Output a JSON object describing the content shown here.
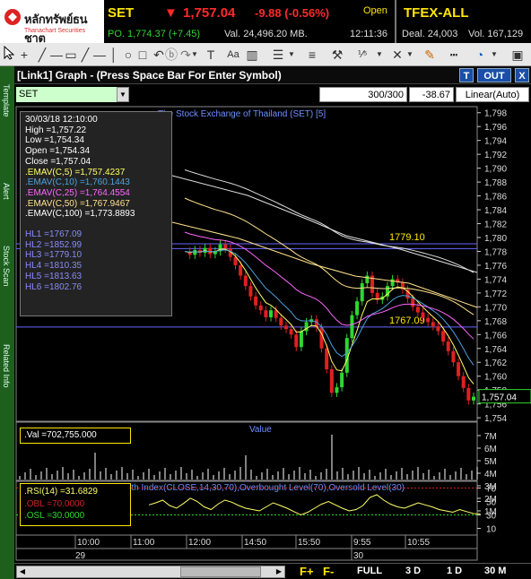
{
  "header": {
    "logo_th": "หลักทรัพย์ธนชาต",
    "logo_en": "Thanachart Securities",
    "index_name": "SET",
    "index_value": "1,757.04",
    "index_change": "-9.88 (-0.56%)",
    "market_status": "Open",
    "po": "PO. 1,774.37 (+7.45)",
    "value_mb": "Val. 24,496.20 MB.",
    "clock": "12:11:36",
    "tfex_name": "TFEX-ALL",
    "tfex_deal": "Deal. 24,003",
    "tfex_vol": "Vol. 167,129",
    "down_color": "#ff2a2a",
    "up_color": "#2fd62f",
    "accent": "#ffe600"
  },
  "toolbar": {
    "icons": [
      "cursor-icon",
      "crosshair-icon",
      "line-icon",
      "hline-icon",
      "rect-icon",
      "circle-icon",
      "square-icon",
      "undo-icon",
      "redo-icon",
      "text-icon",
      "text-tool-label",
      "candle-type-icon",
      "pen-icon",
      "line-width-icon",
      "line-style-icon",
      "tools-icon",
      "wave-icon",
      "delete-icon",
      "pencil-icon",
      "dashed-line-icon",
      "clock-icon",
      "dropdown-icon"
    ],
    "text_tool_label": "Aa"
  },
  "sidebar": {
    "labels": [
      "Template",
      "Alert",
      "Stock Scan",
      "Related Info"
    ]
  },
  "panel": {
    "title": "[Link1] Graph - (Press Space Bar For Enter Symbol)",
    "btn_t": "T",
    "btn_out": "OUT",
    "btn_x": "X",
    "btn_t2": "T"
  },
  "symbol_row": {
    "symbol": "SET",
    "count": "300/300",
    "cursor_value": "-38.67",
    "scale": "Linear(Auto)"
  },
  "chart_title": "The Stock Exchange of Thailand (SET) [5]",
  "info": {
    "datetime": "30/03/18 12:10:00",
    "high": "High =1,757.22",
    "low": "Low =1,754.34",
    "open": "Open =1,754.34",
    "close": "Close =1,757.04",
    "emav5": ".EMAV(C,5)  =1,757.4237",
    "emav10": ".EMAV(C,10) =1,760.1443",
    "emav25": ".EMAV(C,25) =1,764.4554",
    "emav50": ".EMAV(C,50) =1,767.9467",
    "emav100": ".EMAV(C,100) =1,773.8893",
    "hl1": "HL1 =1767.09",
    "hl2": "HL2 =1852.99",
    "hl3": "HL3 =1779.10",
    "hl4": "HL4 =1810.35",
    "hl5": "HL5 =1813.63",
    "hl6": "HL6 =1802.76"
  },
  "hl_labels": {
    "upper": "1779.10",
    "lower": "1767.09"
  },
  "price_axis": [
    "1,798",
    "1,796",
    "1,794",
    "1,792",
    "1,790",
    "1,788",
    "1,786",
    "1,784",
    "1,782",
    "1,780",
    "1,778",
    "1,776",
    "1,774",
    "1,772",
    "1,770",
    "1,768",
    "1,766",
    "1,764",
    "1,762",
    "1,760",
    "1,758",
    "1,756",
    "1,754"
  ],
  "last_price_tag": "1,757.04",
  "volume": {
    "title": "Value",
    "readout": ".Val =702,755.000",
    "axis": [
      "7M",
      "6M",
      "5M",
      "4M",
      "3M",
      "2M",
      "1M"
    ]
  },
  "rsi": {
    "title_prefix": "Relative Strength",
    "title": "Index(CLOSE,14,30,70),Overbought Level(70),Oversold Level(30)",
    "value": ".RSI(14)  =31.6829",
    "obl": ".OBL  =70.0000",
    "osl": ".OSL  =30.0000",
    "axis": [
      "70",
      "50",
      "30",
      "10"
    ]
  },
  "time_axis": {
    "times": [
      "10:00",
      "11:00",
      "12:00",
      "14:50",
      "15:50",
      "9:55",
      "10:55"
    ],
    "days": [
      "29",
      "30"
    ]
  },
  "bottom": {
    "f_plus": "F+",
    "f_minus": "F-",
    "periods": [
      "FULL",
      "3 D",
      "1 D",
      "30 M"
    ]
  },
  "colors": {
    "ema5": "#ffff66",
    "ema10": "#4aa3df",
    "ema25": "#ff66ff",
    "ema50": "#ffe28a",
    "ema100": "#dddddd",
    "hl": "#6666ff",
    "candle_up": "#2fd62f",
    "candle_down": "#e02020"
  }
}
